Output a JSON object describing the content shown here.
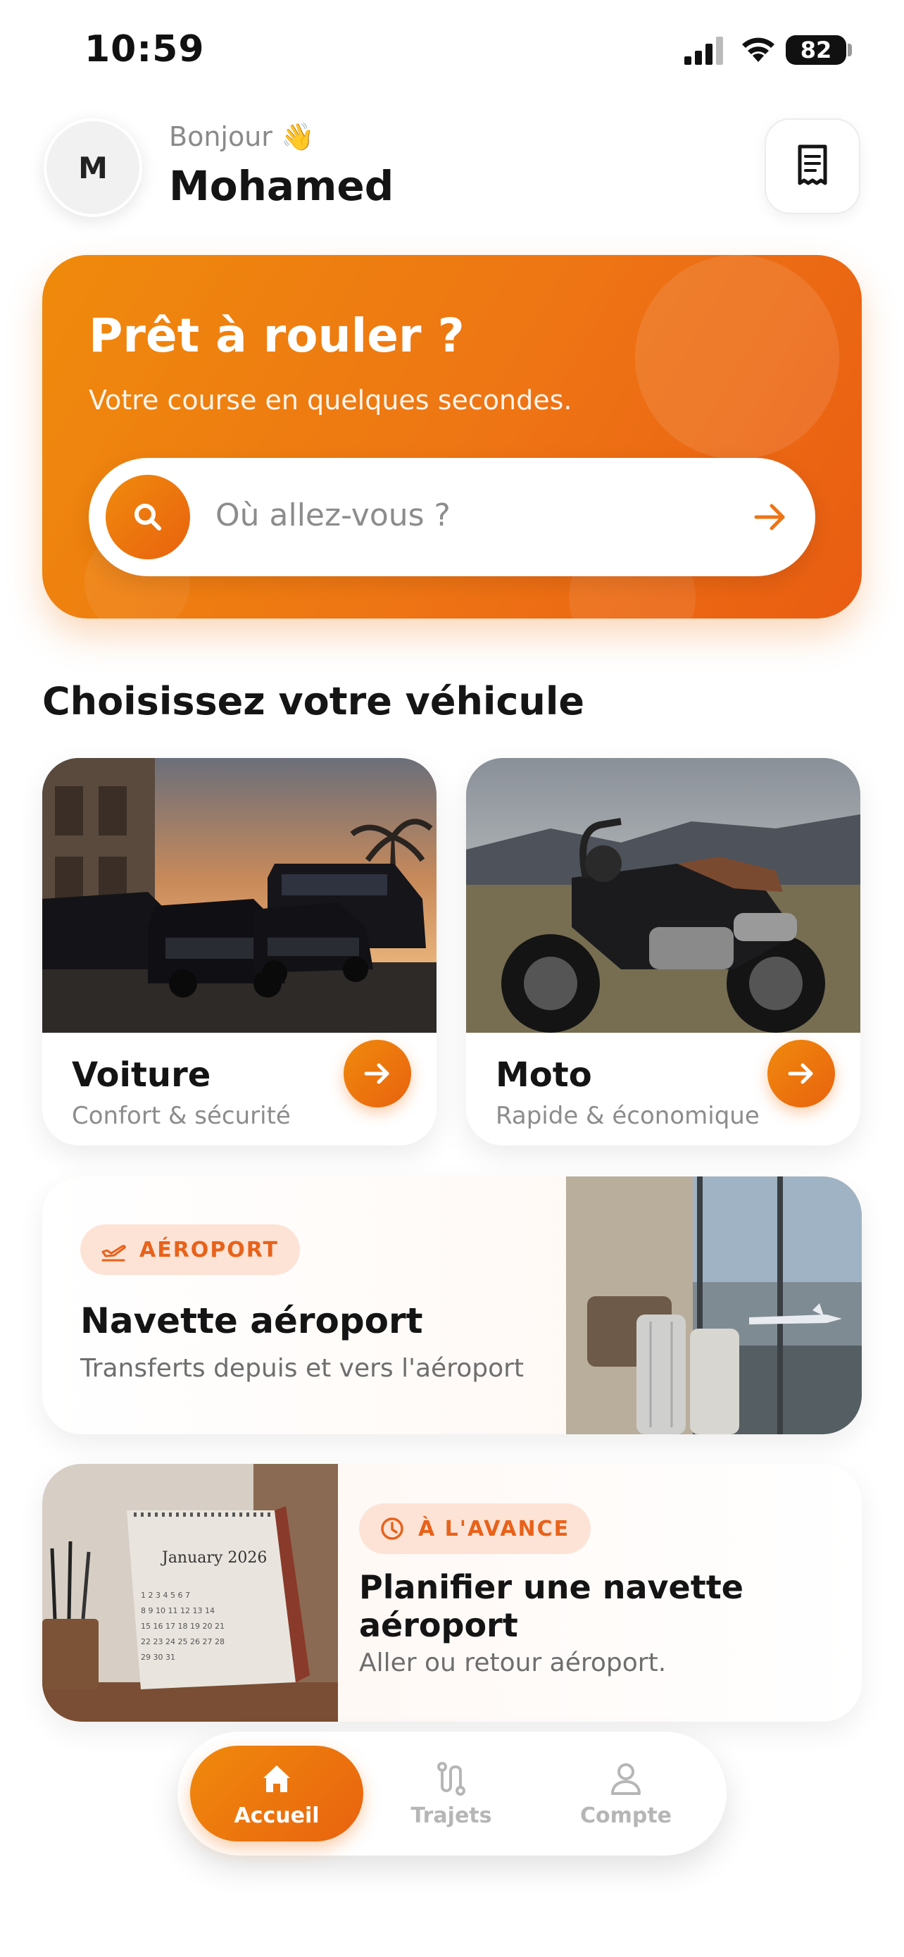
{
  "status_bar": {
    "time": "10:59",
    "battery": "82"
  },
  "header": {
    "avatar_initial": "M",
    "greeting": "Bonjour 👋",
    "user_name": "Mohamed"
  },
  "hero": {
    "title": "Prêt à rouler ?",
    "subtitle": "Votre course en quelques secondes.",
    "search_placeholder": "Où allez-vous ?"
  },
  "vehicles": {
    "section_title": "Choisissez votre véhicule",
    "items": [
      {
        "title": "Voiture",
        "subtitle": "Confort & sécurité",
        "icon": "arrow-right-icon"
      },
      {
        "title": "Moto",
        "subtitle": "Rapide & économique",
        "icon": "arrow-right-icon"
      }
    ]
  },
  "airport_card": {
    "badge": "AÉROPORT",
    "badge_icon": "plane-departure-icon",
    "title": "Navette aéroport",
    "subtitle": "Transferts depuis et vers l'aéroport"
  },
  "plan_card": {
    "badge": "À L'AVANCE",
    "badge_icon": "clock-icon",
    "title": "Planifier une navette aéroport",
    "subtitle": "Aller ou retour aéroport.",
    "calendar_header": "January 2026"
  },
  "tabbar": {
    "items": [
      {
        "label": "Accueil",
        "icon": "home-icon",
        "active": true
      },
      {
        "label": "Trajets",
        "icon": "route-icon",
        "active": false
      },
      {
        "label": "Compte",
        "icon": "user-icon",
        "active": false
      }
    ]
  },
  "colors": {
    "accent": "#EE7414",
    "accent_dark": "#E9620F",
    "badge_bg": "#FDE3D6"
  }
}
